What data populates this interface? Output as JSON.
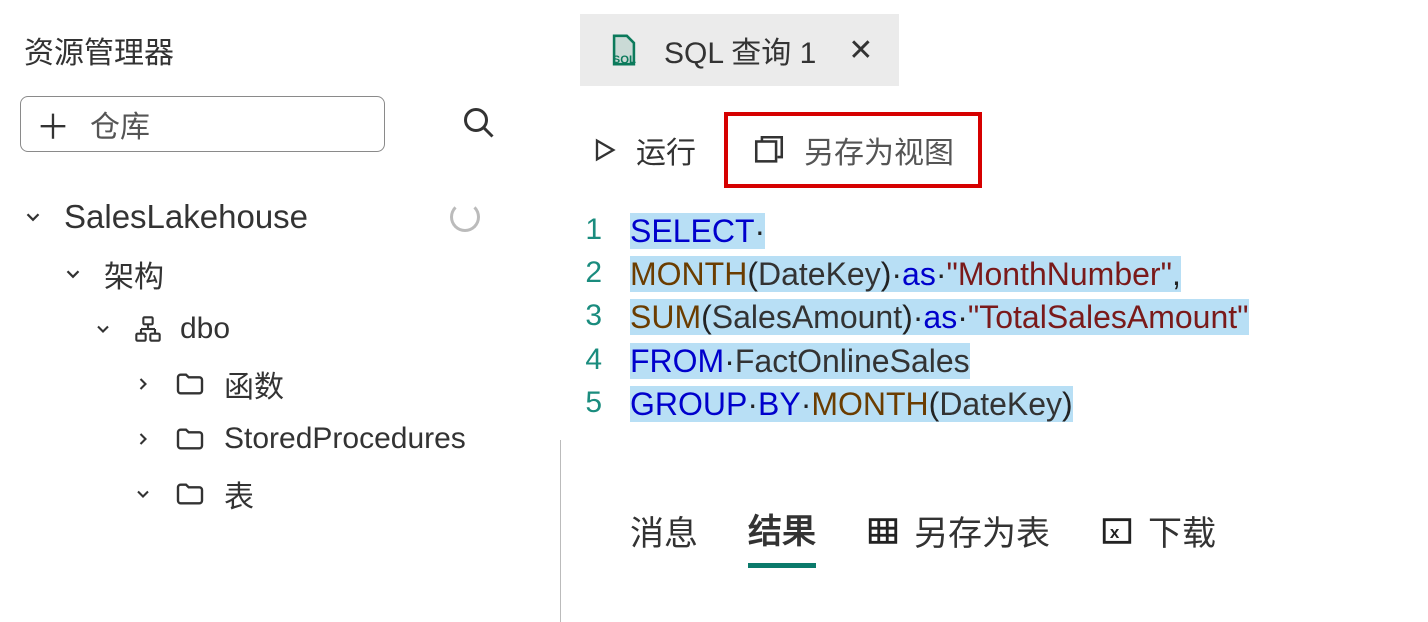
{
  "explorer": {
    "title": "资源管理器",
    "new_placeholder": "仓库",
    "tree": {
      "database": "SalesLakehouse",
      "schema_label": "架构",
      "dbo_label": "dbo",
      "functions_label": "函数",
      "sp_label": "StoredProcedures",
      "tables_label": "表"
    }
  },
  "tab": {
    "label": "SQL 查询 1"
  },
  "toolbar": {
    "run_label": "运行",
    "save_view_label": "另存为视图"
  },
  "editor": {
    "lines": {
      "l1": {
        "num": "1"
      },
      "l2": {
        "num": "2"
      },
      "l3": {
        "num": "3"
      },
      "l4": {
        "num": "4"
      },
      "l5": {
        "num": "5"
      }
    },
    "tokens": {
      "select": "SELECT",
      "month_fn": "MONTH",
      "datekey": "DateKey",
      "as": "as",
      "month_alias": "\"MonthNumber\"",
      "sum_fn": "SUM",
      "salesamount": "SalesAmount",
      "total_alias": "\"TotalSalesAmount\"",
      "from": "FROM",
      "table": "FactOnlineSales",
      "group": "GROUP",
      "by": "BY",
      "dot": "·",
      "comma": ",",
      "lp": "(",
      "rp": ")"
    }
  },
  "results": {
    "messages_label": "消息",
    "results_label": "结果",
    "save_table_label": "另存为表",
    "download_label": "下载"
  }
}
